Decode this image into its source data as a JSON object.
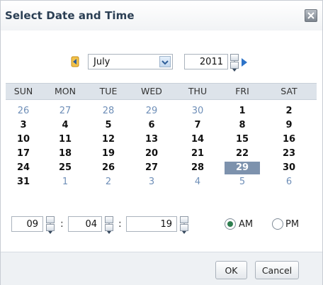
{
  "dialog": {
    "title": "Select Date and Time",
    "close_icon": "close-icon"
  },
  "nav": {
    "month": "July",
    "year": "2011"
  },
  "weekdays": [
    "SUN",
    "MON",
    "TUE",
    "WED",
    "THU",
    "FRI",
    "SAT"
  ],
  "weeks": [
    [
      {
        "d": "26",
        "o": true
      },
      {
        "d": "27",
        "o": true
      },
      {
        "d": "28",
        "o": true
      },
      {
        "d": "29",
        "o": true
      },
      {
        "d": "30",
        "o": true
      },
      {
        "d": "1"
      },
      {
        "d": "2"
      }
    ],
    [
      {
        "d": "3"
      },
      {
        "d": "4"
      },
      {
        "d": "5"
      },
      {
        "d": "6"
      },
      {
        "d": "7"
      },
      {
        "d": "8"
      },
      {
        "d": "9"
      }
    ],
    [
      {
        "d": "10"
      },
      {
        "d": "11"
      },
      {
        "d": "12"
      },
      {
        "d": "13"
      },
      {
        "d": "14"
      },
      {
        "d": "15"
      },
      {
        "d": "16"
      }
    ],
    [
      {
        "d": "17"
      },
      {
        "d": "18"
      },
      {
        "d": "19"
      },
      {
        "d": "20"
      },
      {
        "d": "21"
      },
      {
        "d": "22"
      },
      {
        "d": "23"
      }
    ],
    [
      {
        "d": "24"
      },
      {
        "d": "25"
      },
      {
        "d": "26"
      },
      {
        "d": "27"
      },
      {
        "d": "28"
      },
      {
        "d": "29",
        "s": true
      },
      {
        "d": "30"
      }
    ],
    [
      {
        "d": "31"
      },
      {
        "d": "1",
        "o": true
      },
      {
        "d": "2",
        "o": true
      },
      {
        "d": "3",
        "o": true
      },
      {
        "d": "4",
        "o": true
      },
      {
        "d": "5",
        "o": true
      },
      {
        "d": "6",
        "o": true
      }
    ]
  ],
  "time": {
    "hour": "09",
    "minute": "04",
    "second": "19",
    "separator": ":",
    "am_label": "AM",
    "pm_label": "PM",
    "selected": "AM"
  },
  "buttons": {
    "ok": "OK",
    "cancel": "Cancel"
  },
  "colors": {
    "selected_day": "#7d92ad",
    "other_month_day": "#6f8fb8",
    "title": "#2b3f54"
  }
}
